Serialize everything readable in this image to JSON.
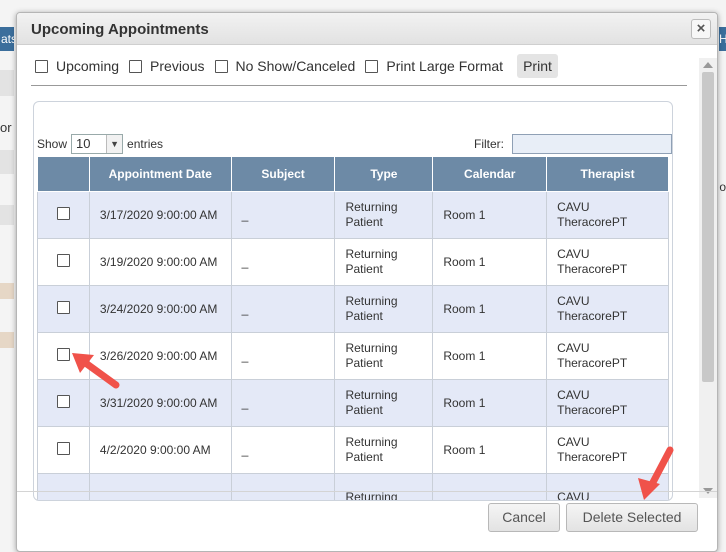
{
  "background": {
    "left_button_fragment": "ats",
    "right_button_fragment": "H",
    "left_text_fragment": "or",
    "right_text_fragment": "o"
  },
  "dialog": {
    "title": "Upcoming Appointments",
    "close_glyph": "×",
    "filters": {
      "upcoming": "Upcoming",
      "previous": "Previous",
      "no_show": "No Show/Canceled",
      "large_format": "Print Large Format"
    },
    "print_label": "Print",
    "table_controls": {
      "show_label": "Show",
      "entries_value": "10",
      "entries_label": "entries",
      "filter_label": "Filter:"
    },
    "columns": [
      "",
      "Appointment Date",
      "Subject",
      "Type",
      "Calendar",
      "Therapist"
    ],
    "rows": [
      {
        "date": "3/17/2020 9:00:00 AM",
        "subject": "_",
        "type": "Returning Patient",
        "calendar": "Room 1",
        "therapist": "CAVU TheracorePT"
      },
      {
        "date": "3/19/2020 9:00:00 AM",
        "subject": "_",
        "type": "Returning Patient",
        "calendar": "Room 1",
        "therapist": "CAVU TheracorePT"
      },
      {
        "date": "3/24/2020 9:00:00 AM",
        "subject": "_",
        "type": "Returning Patient",
        "calendar": "Room 1",
        "therapist": "CAVU TheracorePT"
      },
      {
        "date": "3/26/2020 9:00:00 AM",
        "subject": "_",
        "type": "Returning Patient",
        "calendar": "Room 1",
        "therapist": "CAVU TheracorePT"
      },
      {
        "date": "3/31/2020 9:00:00 AM",
        "subject": "_",
        "type": "Returning Patient",
        "calendar": "Room 1",
        "therapist": "CAVU TheracorePT"
      },
      {
        "date": "4/2/2020 9:00:00 AM",
        "subject": "_",
        "type": "Returning Patient",
        "calendar": "Room 1",
        "therapist": "CAVU TheracorePT"
      },
      {
        "date": "",
        "subject": "",
        "type": "Returning",
        "calendar": "",
        "therapist": "CAVU"
      }
    ],
    "buttons": {
      "cancel": "Cancel",
      "delete_selected": "Delete Selected"
    }
  },
  "colors": {
    "header_bg": "#6d8aa6",
    "row_alt_bg": "#e4e9f7",
    "annotation_arrow": "#f0524a"
  }
}
